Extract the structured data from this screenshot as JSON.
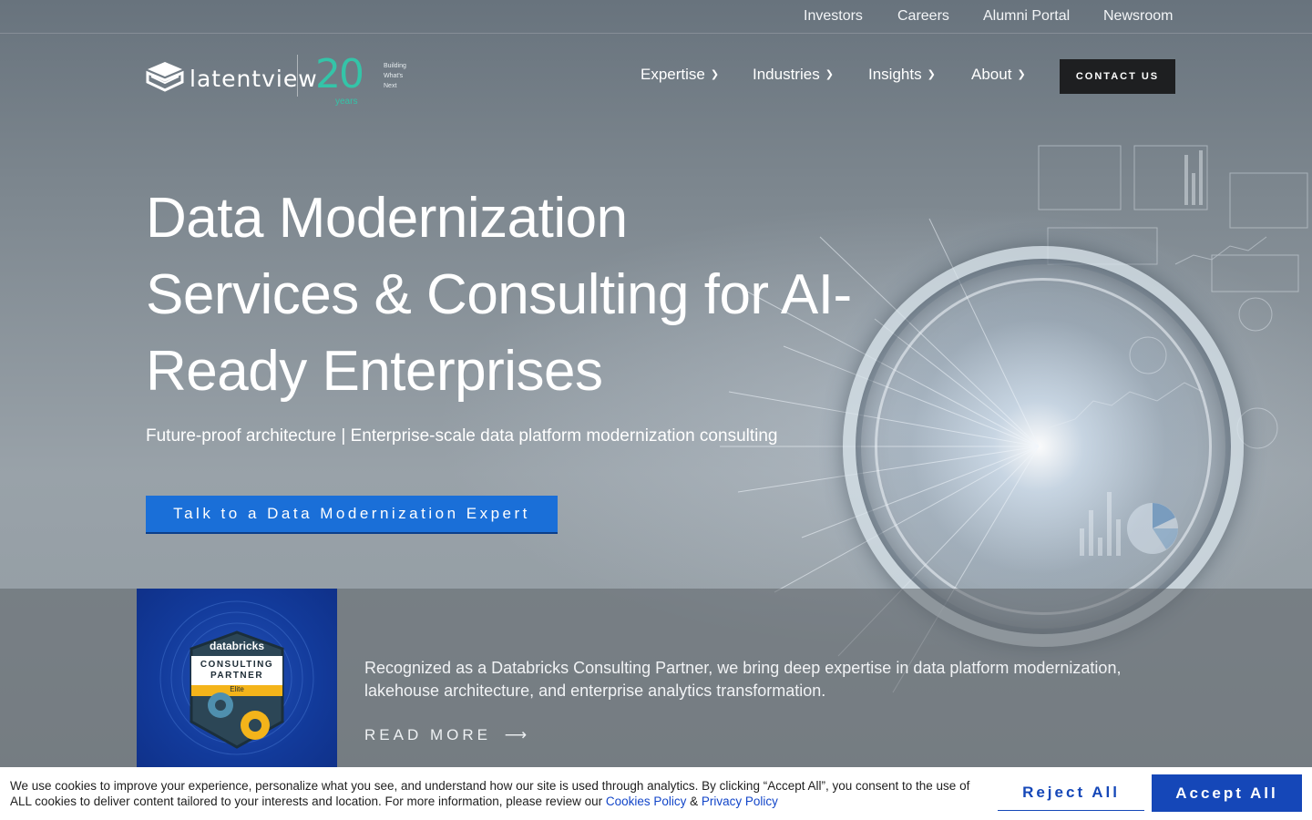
{
  "utility_nav": {
    "items": [
      "Investors",
      "Careers",
      "Alumni Portal",
      "Newsroom"
    ]
  },
  "logo": {
    "text": "latentview",
    "anniversary_number": "20",
    "anniversary_unit": "years",
    "tagline_line1": "Building",
    "tagline_line2": "What's",
    "tagline_line3": "Next"
  },
  "main_nav": {
    "items": [
      "Expertise",
      "Industries",
      "Insights",
      "About"
    ],
    "contact_label": "CONTACT US"
  },
  "hero": {
    "title_line1": "Data Modernization",
    "title_line2": "Services & Consulting for AI-",
    "title_line3": "Ready Enterprises",
    "subtitle": "Future-proof architecture | Enterprise-scale data platform modernization consulting",
    "cta_label": "Talk to a Data Modernization Expert"
  },
  "partner": {
    "badge_brand": "databricks",
    "badge_line1": "CONSULTING",
    "badge_line2": "PARTNER",
    "badge_tier": "Elite",
    "text": "Recognized as a Databricks Consulting Partner, we bring deep expertise in data platform modernization, lakehouse architecture, and enterprise analytics transformation.",
    "read_more_label": "READ MORE"
  },
  "cookie_banner": {
    "text_part1": "We use cookies to improve your experience, personalize what you see, and understand how our site is used through analytics. By clicking “Accept All”, you consent to the use of ALL cookies to deliver content tailored to your interests and location. For more information, please review our ",
    "cookies_policy_link": "Cookies Policy",
    "separator": " & ",
    "privacy_policy_link": "Privacy Policy",
    "reject_label": "Reject All",
    "accept_label": "Accept All"
  },
  "icons": {
    "chevron": "chevron-down-icon",
    "arrow": "arrow-right-icon"
  },
  "colors": {
    "cta_blue": "#1a6fd8",
    "cookie_blue": "#1547b8",
    "anniversary_teal": "#34c4a8",
    "contact_bg": "#1e1f21"
  }
}
